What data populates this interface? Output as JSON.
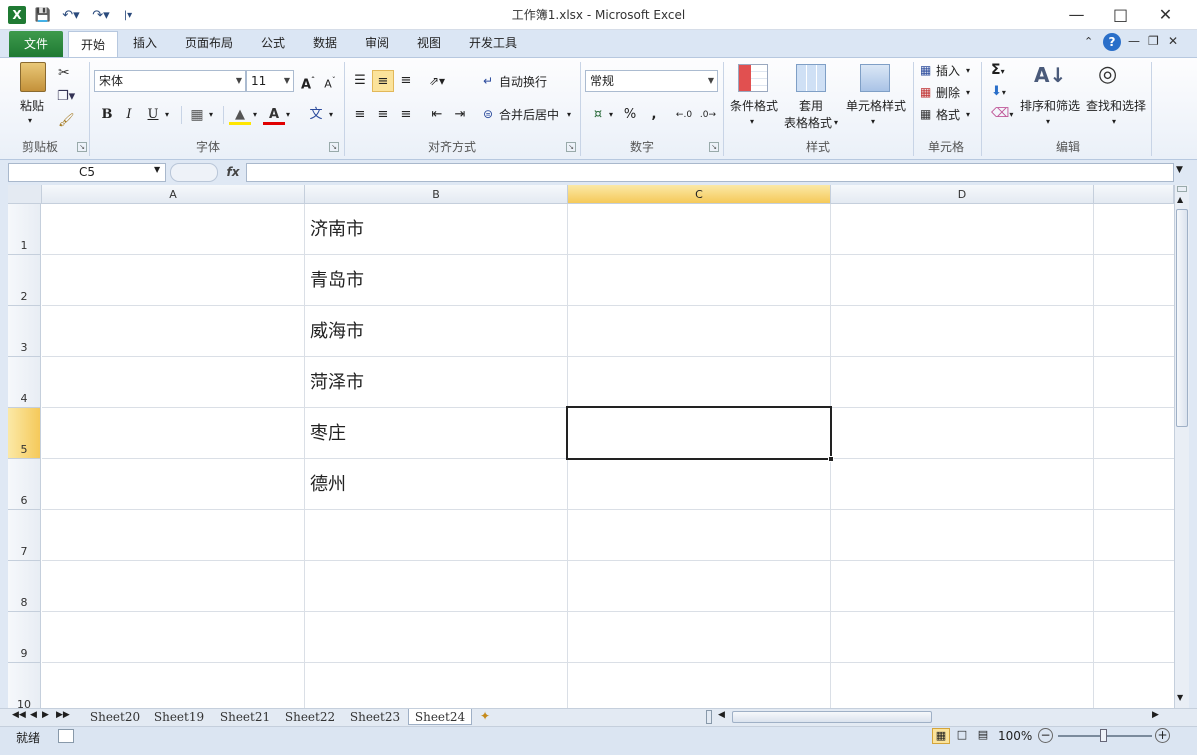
{
  "window": {
    "title": "工作簿1.xlsx - Microsoft Excel"
  },
  "tabs": [
    {
      "label": "文件"
    },
    {
      "label": "开始"
    },
    {
      "label": "插入"
    },
    {
      "label": "页面布局"
    },
    {
      "label": "公式"
    },
    {
      "label": "数据"
    },
    {
      "label": "审阅"
    },
    {
      "label": "视图"
    },
    {
      "label": "开发工具"
    }
  ],
  "ribbon": {
    "clipboard": {
      "paste": "粘贴",
      "label": "剪贴板"
    },
    "font": {
      "name": "宋体",
      "size": "11",
      "label": "字体",
      "bold": "B",
      "italic": "I",
      "underline": "U"
    },
    "alignment": {
      "wrap": "自动换行",
      "merge": "合并后居中",
      "label": "对齐方式"
    },
    "number": {
      "format": "常规",
      "label": "数字",
      "percent": "%",
      "comma": ","
    },
    "styles": {
      "cond": "条件格式",
      "table1": "套用",
      "table2": "表格格式",
      "cell": "单元格样式",
      "label": "样式"
    },
    "cells": {
      "insert": "插入",
      "delete": "删除",
      "format": "格式",
      "label": "单元格"
    },
    "editing": {
      "sort": "排序和筛选",
      "find": "查找和选择",
      "label": "编辑"
    }
  },
  "formula_bar": {
    "name_box": "C5",
    "fx": "fx",
    "formula": ""
  },
  "sheet": {
    "columns": [
      "A",
      "B",
      "C",
      "D"
    ],
    "selected_column": "C",
    "rows": [
      "1",
      "2",
      "3",
      "4",
      "5",
      "6",
      "7",
      "8",
      "9",
      "10"
    ],
    "selected_row": "5",
    "cells_B": [
      "济南市",
      "青岛市",
      "威海市",
      "菏泽市",
      "枣庄",
      "德州"
    ]
  },
  "sheet_tabs": [
    "Sheet20",
    "Sheet19",
    "Sheet21",
    "Sheet22",
    "Sheet23",
    "Sheet24"
  ],
  "active_sheet": "Sheet24",
  "status": {
    "ready": "就绪",
    "zoom": "100%"
  },
  "colors": {
    "accent": "#1f7a33",
    "selection_header": "#f5c95a"
  }
}
